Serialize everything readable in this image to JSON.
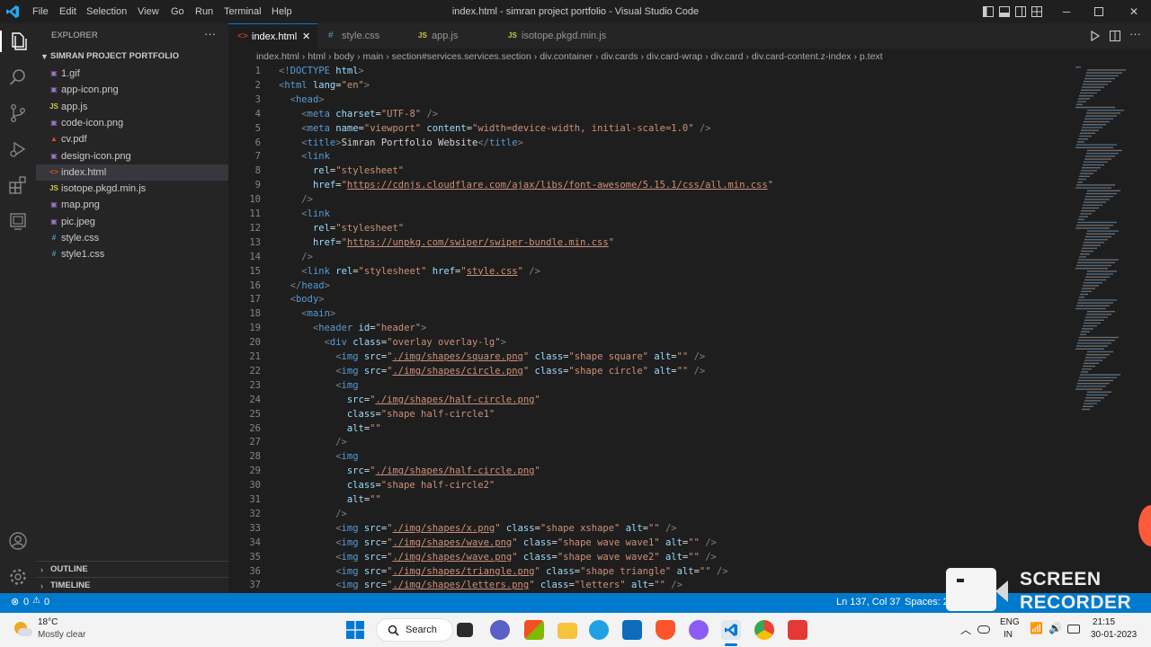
{
  "menu": [
    "File",
    "Edit",
    "Selection",
    "View",
    "Go",
    "Run",
    "Terminal",
    "Help"
  ],
  "window_title": "index.html - simran project portfolio - Visual Studio Code",
  "explorer": {
    "header": "EXPLORER",
    "project": "SIMRAN PROJECT PORTFOLIO",
    "files": [
      {
        "name": "1.gif",
        "icon": "image-icon",
        "color": "#a074c4"
      },
      {
        "name": "app-icon.png",
        "icon": "image-icon",
        "color": "#a074c4"
      },
      {
        "name": "app.js",
        "icon": "js-icon",
        "color": "#cbcb41"
      },
      {
        "name": "code-icon.png",
        "icon": "image-icon",
        "color": "#a074c4"
      },
      {
        "name": "cv.pdf",
        "icon": "pdf-icon",
        "color": "#e44d26"
      },
      {
        "name": "design-icon.png",
        "icon": "image-icon",
        "color": "#a074c4"
      },
      {
        "name": "index.html",
        "icon": "html-icon",
        "color": "#e44d26"
      },
      {
        "name": "isotope.pkgd.min.js",
        "icon": "js-icon",
        "color": "#cbcb41"
      },
      {
        "name": "map.png",
        "icon": "image-icon",
        "color": "#a074c4"
      },
      {
        "name": "pic.jpeg",
        "icon": "image-icon",
        "color": "#a074c4"
      },
      {
        "name": "style.css",
        "icon": "css-icon",
        "color": "#519aba"
      },
      {
        "name": "style1.css",
        "icon": "css-icon",
        "color": "#519aba"
      }
    ],
    "outline": "OUTLINE",
    "timeline": "TIMELINE"
  },
  "tabs": [
    {
      "label": "index.html",
      "icon": "html-icon",
      "active": true
    },
    {
      "label": "style.css",
      "icon": "css-icon",
      "active": false
    },
    {
      "label": "app.js",
      "icon": "js-icon",
      "active": false
    },
    {
      "label": "isotope.pkgd.min.js",
      "icon": "js-icon",
      "active": false
    }
  ],
  "breadcrumb": [
    "index.html",
    "html",
    "body",
    "main",
    "section#services.services.section",
    "div.container",
    "div.cards",
    "div.card-wrap",
    "div.card",
    "div.card-content.z-index",
    "p.text"
  ],
  "code_lines": [
    [
      [
        "t-punc",
        "<!"
      ],
      [
        "t-tag",
        "DOCTYPE"
      ],
      [
        "t-txt",
        " "
      ],
      [
        "t-attr",
        "html"
      ],
      [
        "t-punc",
        ">"
      ]
    ],
    [
      [
        "t-punc",
        "<"
      ],
      [
        "t-tag",
        "html"
      ],
      [
        "t-txt",
        " "
      ],
      [
        "t-attr",
        "lang"
      ],
      [
        "t-txt",
        "="
      ],
      [
        "t-str",
        "\"en\""
      ],
      [
        "t-punc",
        ">"
      ]
    ],
    [
      [
        "t-txt",
        "  "
      ],
      [
        "t-punc",
        "<"
      ],
      [
        "t-tag",
        "head"
      ],
      [
        "t-punc",
        ">"
      ]
    ],
    [
      [
        "t-txt",
        "    "
      ],
      [
        "t-punc",
        "<"
      ],
      [
        "t-tag",
        "meta"
      ],
      [
        "t-txt",
        " "
      ],
      [
        "t-attr",
        "charset"
      ],
      [
        "t-txt",
        "="
      ],
      [
        "t-str",
        "\"UTF-8\""
      ],
      [
        "t-txt",
        " "
      ],
      [
        "t-punc",
        "/>"
      ]
    ],
    [
      [
        "t-txt",
        "    "
      ],
      [
        "t-punc",
        "<"
      ],
      [
        "t-tag",
        "meta"
      ],
      [
        "t-txt",
        " "
      ],
      [
        "t-attr",
        "name"
      ],
      [
        "t-txt",
        "="
      ],
      [
        "t-str",
        "\"viewport\""
      ],
      [
        "t-txt",
        " "
      ],
      [
        "t-attr",
        "content"
      ],
      [
        "t-txt",
        "="
      ],
      [
        "t-str",
        "\"width=device-width, initial-scale=1.0\""
      ],
      [
        "t-txt",
        " "
      ],
      [
        "t-punc",
        "/>"
      ]
    ],
    [
      [
        "t-txt",
        "    "
      ],
      [
        "t-punc",
        "<"
      ],
      [
        "t-tag",
        "title"
      ],
      [
        "t-punc",
        ">"
      ],
      [
        "t-txt",
        "Simran Portfolio Website"
      ],
      [
        "t-punc",
        "</"
      ],
      [
        "t-tag",
        "title"
      ],
      [
        "t-punc",
        ">"
      ]
    ],
    [
      [
        "t-txt",
        "    "
      ],
      [
        "t-punc",
        "<"
      ],
      [
        "t-tag",
        "link"
      ]
    ],
    [
      [
        "t-txt",
        "      "
      ],
      [
        "t-attr",
        "rel"
      ],
      [
        "t-txt",
        "="
      ],
      [
        "t-str",
        "\"stylesheet\""
      ]
    ],
    [
      [
        "t-txt",
        "      "
      ],
      [
        "t-attr",
        "href"
      ],
      [
        "t-txt",
        "="
      ],
      [
        "t-str",
        "\""
      ],
      [
        "t-str u",
        "https://cdnjs.cloudflare.com/ajax/libs/font-awesome/5.15.1/css/all.min.css"
      ],
      [
        "t-str",
        "\""
      ]
    ],
    [
      [
        "t-txt",
        "    "
      ],
      [
        "t-punc",
        "/>"
      ]
    ],
    [
      [
        "t-txt",
        "    "
      ],
      [
        "t-punc",
        "<"
      ],
      [
        "t-tag",
        "link"
      ]
    ],
    [
      [
        "t-txt",
        "      "
      ],
      [
        "t-attr",
        "rel"
      ],
      [
        "t-txt",
        "="
      ],
      [
        "t-str",
        "\"stylesheet\""
      ]
    ],
    [
      [
        "t-txt",
        "      "
      ],
      [
        "t-attr",
        "href"
      ],
      [
        "t-txt",
        "="
      ],
      [
        "t-str",
        "\""
      ],
      [
        "t-str u",
        "https://unpkg.com/swiper/swiper-bundle.min.css"
      ],
      [
        "t-str",
        "\""
      ]
    ],
    [
      [
        "t-txt",
        "    "
      ],
      [
        "t-punc",
        "/>"
      ]
    ],
    [
      [
        "t-txt",
        "    "
      ],
      [
        "t-punc",
        "<"
      ],
      [
        "t-tag",
        "link"
      ],
      [
        "t-txt",
        " "
      ],
      [
        "t-attr",
        "rel"
      ],
      [
        "t-txt",
        "="
      ],
      [
        "t-str",
        "\"stylesheet\""
      ],
      [
        "t-txt",
        " "
      ],
      [
        "t-attr",
        "href"
      ],
      [
        "t-txt",
        "="
      ],
      [
        "t-str",
        "\""
      ],
      [
        "t-str u",
        "style.css"
      ],
      [
        "t-str",
        "\""
      ],
      [
        "t-txt",
        " "
      ],
      [
        "t-punc",
        "/>"
      ]
    ],
    [
      [
        "t-txt",
        "  "
      ],
      [
        "t-punc",
        "</"
      ],
      [
        "t-tag",
        "head"
      ],
      [
        "t-punc",
        ">"
      ]
    ],
    [
      [
        "t-txt",
        "  "
      ],
      [
        "t-punc",
        "<"
      ],
      [
        "t-tag",
        "body"
      ],
      [
        "t-punc",
        ">"
      ]
    ],
    [
      [
        "t-txt",
        "    "
      ],
      [
        "t-punc",
        "<"
      ],
      [
        "t-tag",
        "main"
      ],
      [
        "t-punc",
        ">"
      ]
    ],
    [
      [
        "t-txt",
        "      "
      ],
      [
        "t-punc",
        "<"
      ],
      [
        "t-tag",
        "header"
      ],
      [
        "t-txt",
        " "
      ],
      [
        "t-attr",
        "id"
      ],
      [
        "t-txt",
        "="
      ],
      [
        "t-str",
        "\"header\""
      ],
      [
        "t-punc",
        ">"
      ]
    ],
    [
      [
        "t-txt",
        "        "
      ],
      [
        "t-punc",
        "<"
      ],
      [
        "t-tag",
        "div"
      ],
      [
        "t-txt",
        " "
      ],
      [
        "t-attr",
        "class"
      ],
      [
        "t-txt",
        "="
      ],
      [
        "t-str",
        "\"overlay overlay-lg\""
      ],
      [
        "t-punc",
        ">"
      ]
    ],
    [
      [
        "t-txt",
        "          "
      ],
      [
        "t-punc",
        "<"
      ],
      [
        "t-tag",
        "img"
      ],
      [
        "t-txt",
        " "
      ],
      [
        "t-attr",
        "src"
      ],
      [
        "t-txt",
        "="
      ],
      [
        "t-str",
        "\""
      ],
      [
        "t-str u",
        "./img/shapes/square.png"
      ],
      [
        "t-str",
        "\""
      ],
      [
        "t-txt",
        " "
      ],
      [
        "t-attr",
        "class"
      ],
      [
        "t-txt",
        "="
      ],
      [
        "t-str",
        "\"shape square\""
      ],
      [
        "t-txt",
        " "
      ],
      [
        "t-attr",
        "alt"
      ],
      [
        "t-txt",
        "="
      ],
      [
        "t-str",
        "\"\""
      ],
      [
        "t-txt",
        " "
      ],
      [
        "t-punc",
        "/>"
      ]
    ],
    [
      [
        "t-txt",
        "          "
      ],
      [
        "t-punc",
        "<"
      ],
      [
        "t-tag",
        "img"
      ],
      [
        "t-txt",
        " "
      ],
      [
        "t-attr",
        "src"
      ],
      [
        "t-txt",
        "="
      ],
      [
        "t-str",
        "\""
      ],
      [
        "t-str u",
        "./img/shapes/circle.png"
      ],
      [
        "t-str",
        "\""
      ],
      [
        "t-txt",
        " "
      ],
      [
        "t-attr",
        "class"
      ],
      [
        "t-txt",
        "="
      ],
      [
        "t-str",
        "\"shape circle\""
      ],
      [
        "t-txt",
        " "
      ],
      [
        "t-attr",
        "alt"
      ],
      [
        "t-txt",
        "="
      ],
      [
        "t-str",
        "\"\""
      ],
      [
        "t-txt",
        " "
      ],
      [
        "t-punc",
        "/>"
      ]
    ],
    [
      [
        "t-txt",
        "          "
      ],
      [
        "t-punc",
        "<"
      ],
      [
        "t-tag",
        "img"
      ]
    ],
    [
      [
        "t-txt",
        "            "
      ],
      [
        "t-attr",
        "src"
      ],
      [
        "t-txt",
        "="
      ],
      [
        "t-str",
        "\""
      ],
      [
        "t-str u",
        "./img/shapes/half-circle.png"
      ],
      [
        "t-str",
        "\""
      ]
    ],
    [
      [
        "t-txt",
        "            "
      ],
      [
        "t-attr",
        "class"
      ],
      [
        "t-txt",
        "="
      ],
      [
        "t-str",
        "\"shape half-circle1\""
      ]
    ],
    [
      [
        "t-txt",
        "            "
      ],
      [
        "t-attr",
        "alt"
      ],
      [
        "t-txt",
        "="
      ],
      [
        "t-str",
        "\"\""
      ]
    ],
    [
      [
        "t-txt",
        "          "
      ],
      [
        "t-punc",
        "/>"
      ]
    ],
    [
      [
        "t-txt",
        "          "
      ],
      [
        "t-punc",
        "<"
      ],
      [
        "t-tag",
        "img"
      ]
    ],
    [
      [
        "t-txt",
        "            "
      ],
      [
        "t-attr",
        "src"
      ],
      [
        "t-txt",
        "="
      ],
      [
        "t-str",
        "\""
      ],
      [
        "t-str u",
        "./img/shapes/half-circle.png"
      ],
      [
        "t-str",
        "\""
      ]
    ],
    [
      [
        "t-txt",
        "            "
      ],
      [
        "t-attr",
        "class"
      ],
      [
        "t-txt",
        "="
      ],
      [
        "t-str",
        "\"shape half-circle2\""
      ]
    ],
    [
      [
        "t-txt",
        "            "
      ],
      [
        "t-attr",
        "alt"
      ],
      [
        "t-txt",
        "="
      ],
      [
        "t-str",
        "\"\""
      ]
    ],
    [
      [
        "t-txt",
        "          "
      ],
      [
        "t-punc",
        "/>"
      ]
    ],
    [
      [
        "t-txt",
        "          "
      ],
      [
        "t-punc",
        "<"
      ],
      [
        "t-tag",
        "img"
      ],
      [
        "t-txt",
        " "
      ],
      [
        "t-attr",
        "src"
      ],
      [
        "t-txt",
        "="
      ],
      [
        "t-str",
        "\""
      ],
      [
        "t-str u",
        "./img/shapes/x.png"
      ],
      [
        "t-str",
        "\""
      ],
      [
        "t-txt",
        " "
      ],
      [
        "t-attr",
        "class"
      ],
      [
        "t-txt",
        "="
      ],
      [
        "t-str",
        "\"shape xshape\""
      ],
      [
        "t-txt",
        " "
      ],
      [
        "t-attr",
        "alt"
      ],
      [
        "t-txt",
        "="
      ],
      [
        "t-str",
        "\"\""
      ],
      [
        "t-txt",
        " "
      ],
      [
        "t-punc",
        "/>"
      ]
    ],
    [
      [
        "t-txt",
        "          "
      ],
      [
        "t-punc",
        "<"
      ],
      [
        "t-tag",
        "img"
      ],
      [
        "t-txt",
        " "
      ],
      [
        "t-attr",
        "src"
      ],
      [
        "t-txt",
        "="
      ],
      [
        "t-str",
        "\""
      ],
      [
        "t-str u",
        "./img/shapes/wave.png"
      ],
      [
        "t-str",
        "\""
      ],
      [
        "t-txt",
        " "
      ],
      [
        "t-attr",
        "class"
      ],
      [
        "t-txt",
        "="
      ],
      [
        "t-str",
        "\"shape wave wave1\""
      ],
      [
        "t-txt",
        " "
      ],
      [
        "t-attr",
        "alt"
      ],
      [
        "t-txt",
        "="
      ],
      [
        "t-str",
        "\"\""
      ],
      [
        "t-txt",
        " "
      ],
      [
        "t-punc",
        "/>"
      ]
    ],
    [
      [
        "t-txt",
        "          "
      ],
      [
        "t-punc",
        "<"
      ],
      [
        "t-tag",
        "img"
      ],
      [
        "t-txt",
        " "
      ],
      [
        "t-attr",
        "src"
      ],
      [
        "t-txt",
        "="
      ],
      [
        "t-str",
        "\""
      ],
      [
        "t-str u",
        "./img/shapes/wave.png"
      ],
      [
        "t-str",
        "\""
      ],
      [
        "t-txt",
        " "
      ],
      [
        "t-attr",
        "class"
      ],
      [
        "t-txt",
        "="
      ],
      [
        "t-str",
        "\"shape wave wave2\""
      ],
      [
        "t-txt",
        " "
      ],
      [
        "t-attr",
        "alt"
      ],
      [
        "t-txt",
        "="
      ],
      [
        "t-str",
        "\"\""
      ],
      [
        "t-txt",
        " "
      ],
      [
        "t-punc",
        "/>"
      ]
    ],
    [
      [
        "t-txt",
        "          "
      ],
      [
        "t-punc",
        "<"
      ],
      [
        "t-tag",
        "img"
      ],
      [
        "t-txt",
        " "
      ],
      [
        "t-attr",
        "src"
      ],
      [
        "t-txt",
        "="
      ],
      [
        "t-str",
        "\""
      ],
      [
        "t-str u",
        "./img/shapes/triangle.png"
      ],
      [
        "t-str",
        "\""
      ],
      [
        "t-txt",
        " "
      ],
      [
        "t-attr",
        "class"
      ],
      [
        "t-txt",
        "="
      ],
      [
        "t-str",
        "\"shape triangle\""
      ],
      [
        "t-txt",
        " "
      ],
      [
        "t-attr",
        "alt"
      ],
      [
        "t-txt",
        "="
      ],
      [
        "t-str",
        "\"\""
      ],
      [
        "t-txt",
        " "
      ],
      [
        "t-punc",
        "/>"
      ]
    ],
    [
      [
        "t-txt",
        "          "
      ],
      [
        "t-punc",
        "<"
      ],
      [
        "t-tag",
        "img"
      ],
      [
        "t-txt",
        " "
      ],
      [
        "t-attr",
        "src"
      ],
      [
        "t-txt",
        "="
      ],
      [
        "t-str",
        "\""
      ],
      [
        "t-str u",
        "./img/shapes/letters.png"
      ],
      [
        "t-str",
        "\""
      ],
      [
        "t-txt",
        " "
      ],
      [
        "t-attr",
        "class"
      ],
      [
        "t-txt",
        "="
      ],
      [
        "t-str",
        "\"letters\""
      ],
      [
        "t-txt",
        " "
      ],
      [
        "t-attr",
        "alt"
      ],
      [
        "t-txt",
        "="
      ],
      [
        "t-str",
        "\"\""
      ],
      [
        "t-txt",
        " "
      ],
      [
        "t-punc",
        "/>"
      ]
    ]
  ],
  "status": {
    "problems": "0",
    "warnings": "0",
    "position": "Ln 137, Col 37",
    "spaces": "Spaces: 2"
  },
  "taskbar": {
    "temperature": "18°C",
    "weather": "Mostly clear",
    "search": "Search",
    "lang_line1": "ENG",
    "lang_line2": "IN",
    "time": "21:15",
    "date": "30-01-2023"
  },
  "recorder": {
    "line1": "SCREEN",
    "line2": "RECORDER"
  },
  "colors": {
    "status_bar": "#007acc",
    "accent": "#0078d4"
  }
}
